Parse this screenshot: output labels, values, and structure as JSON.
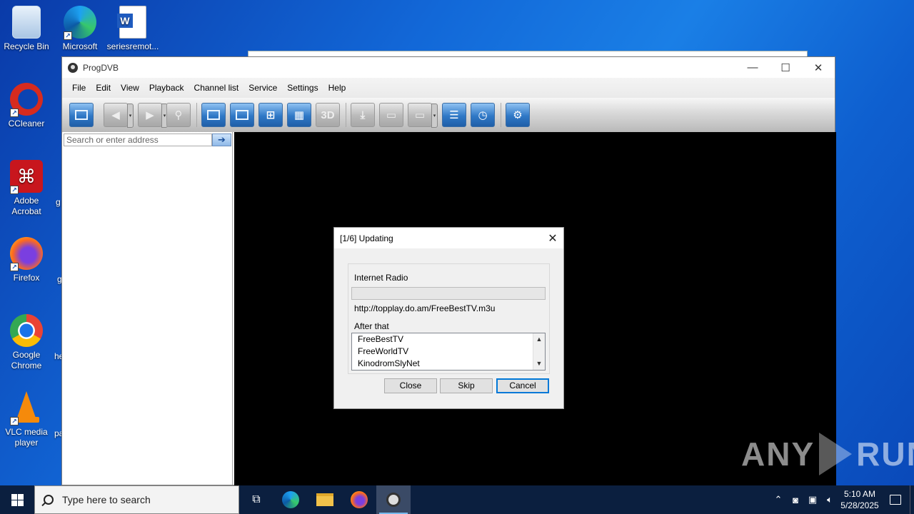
{
  "desktop": {
    "icons": [
      {
        "label": "Recycle Bin",
        "icon": "recycle-bin-icon"
      },
      {
        "label": "Microsoft Edge",
        "icon": "edge-icon"
      },
      {
        "label": "seriesremot...",
        "icon": "word-document-icon"
      },
      {
        "label": "CCleaner",
        "icon": "ccleaner-icon"
      },
      {
        "label": "Adobe Acrobat",
        "icon": "acrobat-icon"
      },
      {
        "label": "Firefox",
        "icon": "firefox-icon"
      },
      {
        "label": "Google Chrome",
        "icon": "chrome-icon"
      },
      {
        "label": "VLC media player",
        "icon": "vlc-icon"
      }
    ],
    "partial_labels": [
      "g",
      "g",
      "he",
      "pa"
    ]
  },
  "window": {
    "title": "ProgDVB",
    "menu": [
      "File",
      "Edit",
      "View",
      "Playback",
      "Channel list",
      "Service",
      "Settings",
      "Help"
    ],
    "search_placeholder": "Search or enter address",
    "search_go": "➔",
    "toolbar_3d": "3D"
  },
  "dialog": {
    "title": "[1/6] Updating",
    "current_item": "Internet Radio",
    "url": "http://topplay.do.am/FreeBestTV.m3u",
    "after_label": "After that",
    "queue": [
      "FreeBestTV",
      "FreeWorldTV",
      "KinodromSlyNet"
    ],
    "buttons": {
      "close": "Close",
      "skip": "Skip",
      "cancel": "Cancel"
    },
    "progress": 0
  },
  "watermark": {
    "left": "ANY",
    "right": "RUN"
  },
  "taskbar": {
    "search_placeholder": "Type here to search",
    "time": "5:10 AM",
    "date": "5/28/2025"
  },
  "colors": {
    "desktop_accent": "#1268d8",
    "taskbar": "#0b1f3f",
    "toolbar_button": "#2f78c6",
    "dialog_default_border": "#0078d7"
  }
}
